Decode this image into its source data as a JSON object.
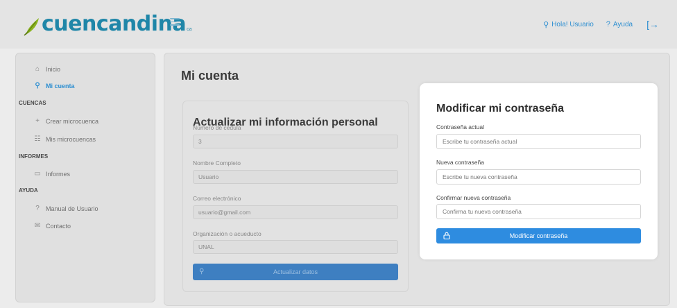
{
  "header": {
    "logo_text": "cuencandina",
    "logo_suffix": "ca",
    "user_greeting": "Hola! Usuario",
    "help_label": "Ayuda"
  },
  "sidebar": {
    "items_top": [
      {
        "label": "Inicio",
        "icon": "home-icon"
      },
      {
        "label": "Mi cuenta",
        "icon": "user-icon",
        "active": true
      }
    ],
    "sections": [
      {
        "title": "CUENCAS",
        "items": [
          {
            "label": "Crear microcuenca",
            "icon": "plus-icon"
          },
          {
            "label": "Mis microcuencas",
            "icon": "list-icon"
          }
        ]
      },
      {
        "title": "INFORMES",
        "items": [
          {
            "label": "Informes",
            "icon": "folder-icon"
          }
        ]
      },
      {
        "title": "AYUDA",
        "items": [
          {
            "label": "Manual de Usuario",
            "icon": "question-icon"
          },
          {
            "label": "Contacto",
            "icon": "mail-icon"
          }
        ]
      }
    ]
  },
  "main": {
    "page_title": "Mi cuenta",
    "info_card": {
      "title": "Actualizar mi información personal",
      "fields": [
        {
          "label": "Número de cedula",
          "value": "3"
        },
        {
          "label": "Nombre Completo",
          "value": "Usuario"
        },
        {
          "label": "Correo electrónico",
          "value": "usuario@gmail.com"
        },
        {
          "label": "Organización o acueducto",
          "value": "UNAL"
        }
      ],
      "button_label": "Actualizar datos"
    },
    "password_card": {
      "title": "Modificar mi contraseña",
      "current_label": "Contraseña actual",
      "current_placeholder": "Escribe tu contraseña actual",
      "new_label": "Nueva contraseña",
      "new_placeholder": "Escribe tu nueva contraseña",
      "confirm_label": "Confirmar nueva contraseña",
      "confirm_placeholder": "Confirma tu nueva contraseña",
      "button_label": "Modificar contraseña"
    }
  },
  "colors": {
    "brand": "#1f86a8",
    "accent": "#2e8ce0",
    "leaf_green": "#8ab31e"
  }
}
